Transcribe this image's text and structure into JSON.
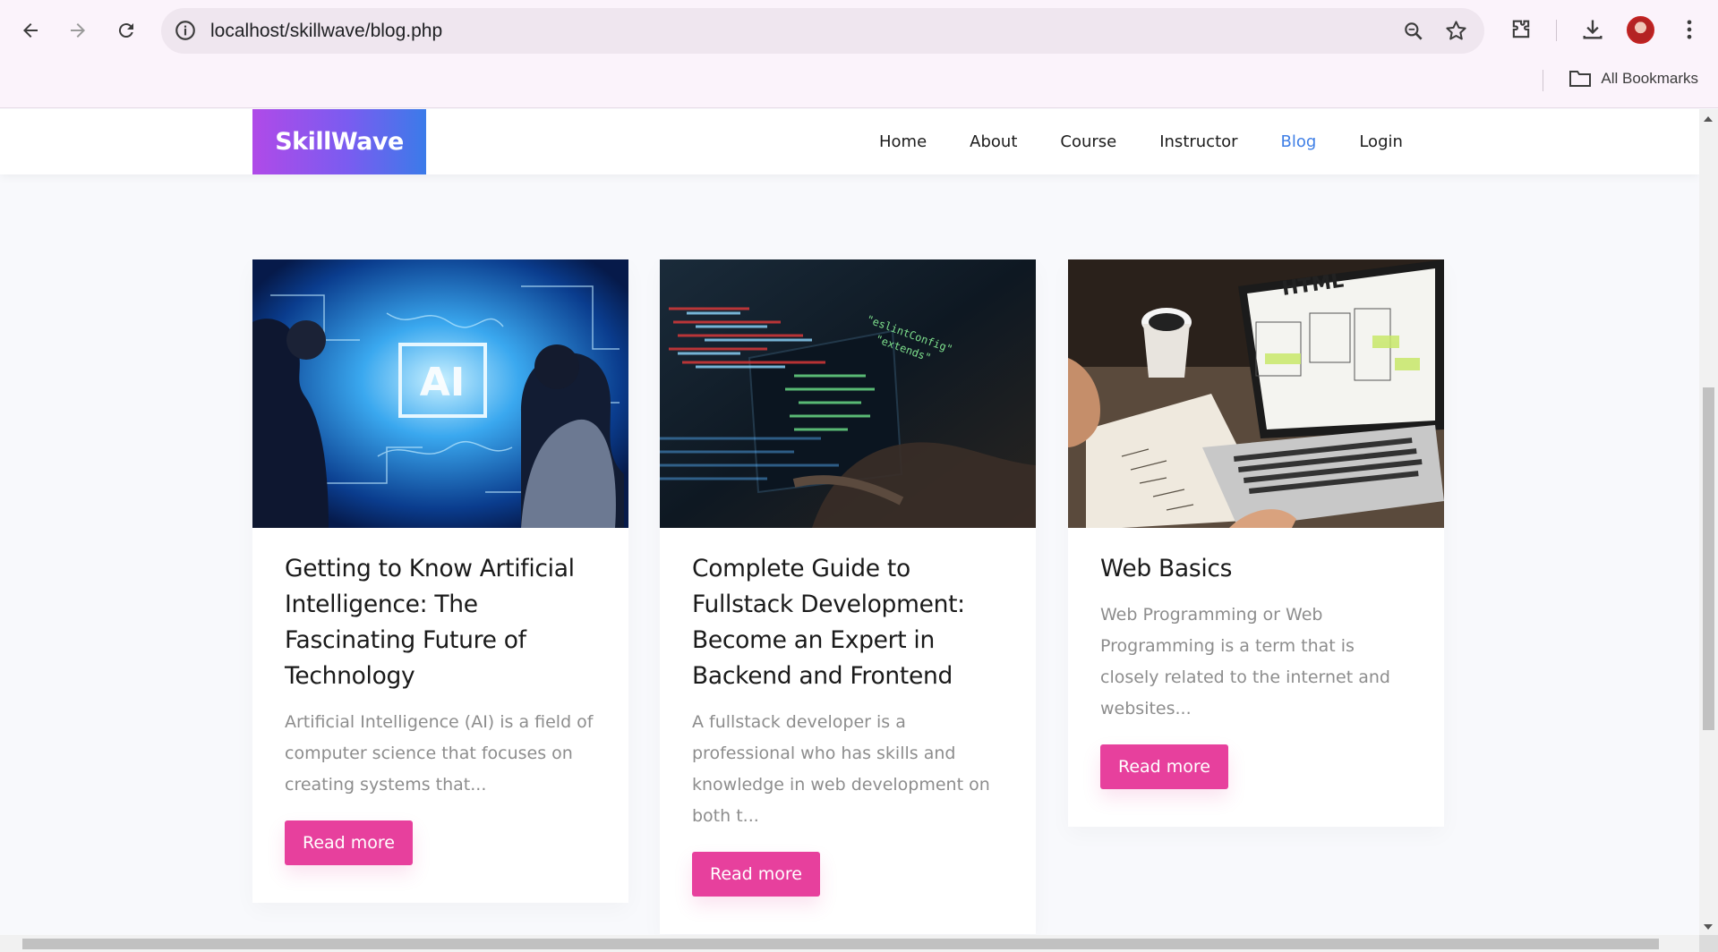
{
  "browser": {
    "url": "localhost/skillwave/blog.php",
    "bookmarks_label": "All Bookmarks",
    "icons": [
      "back-icon",
      "forward-icon",
      "reload-icon",
      "info-icon",
      "zoom-icon",
      "star-icon",
      "extensions-icon",
      "download-icon",
      "profile-avatar",
      "menu-kebab-icon",
      "folder-icon"
    ]
  },
  "site": {
    "logo": "SkillWave",
    "nav": [
      {
        "label": "Home"
      },
      {
        "label": "About"
      },
      {
        "label": "Course"
      },
      {
        "label": "Instructor"
      },
      {
        "label": "Blog",
        "active": true
      },
      {
        "label": "Login"
      }
    ],
    "accent_color": "#e7409d",
    "active_nav_color": "#3f7fe6"
  },
  "posts": [
    {
      "title": "Getting to Know Artificial Intelligence: The Fascinating Future of Technology",
      "excerpt": "Artificial Intelligence (AI) is a field of computer science that focuses on creating systems that...",
      "button": "Read more"
    },
    {
      "title": "Complete Guide to Fullstack Development: Become an Expert in Backend and Frontend",
      "excerpt": "A fullstack developer is a professional who has skills and knowledge in web development on both t...",
      "button": "Read more"
    },
    {
      "title": "Web Basics",
      "excerpt": "Web Programming or Web Programming is a term that is closely related to the internet and websites...",
      "button": "Read more"
    }
  ]
}
